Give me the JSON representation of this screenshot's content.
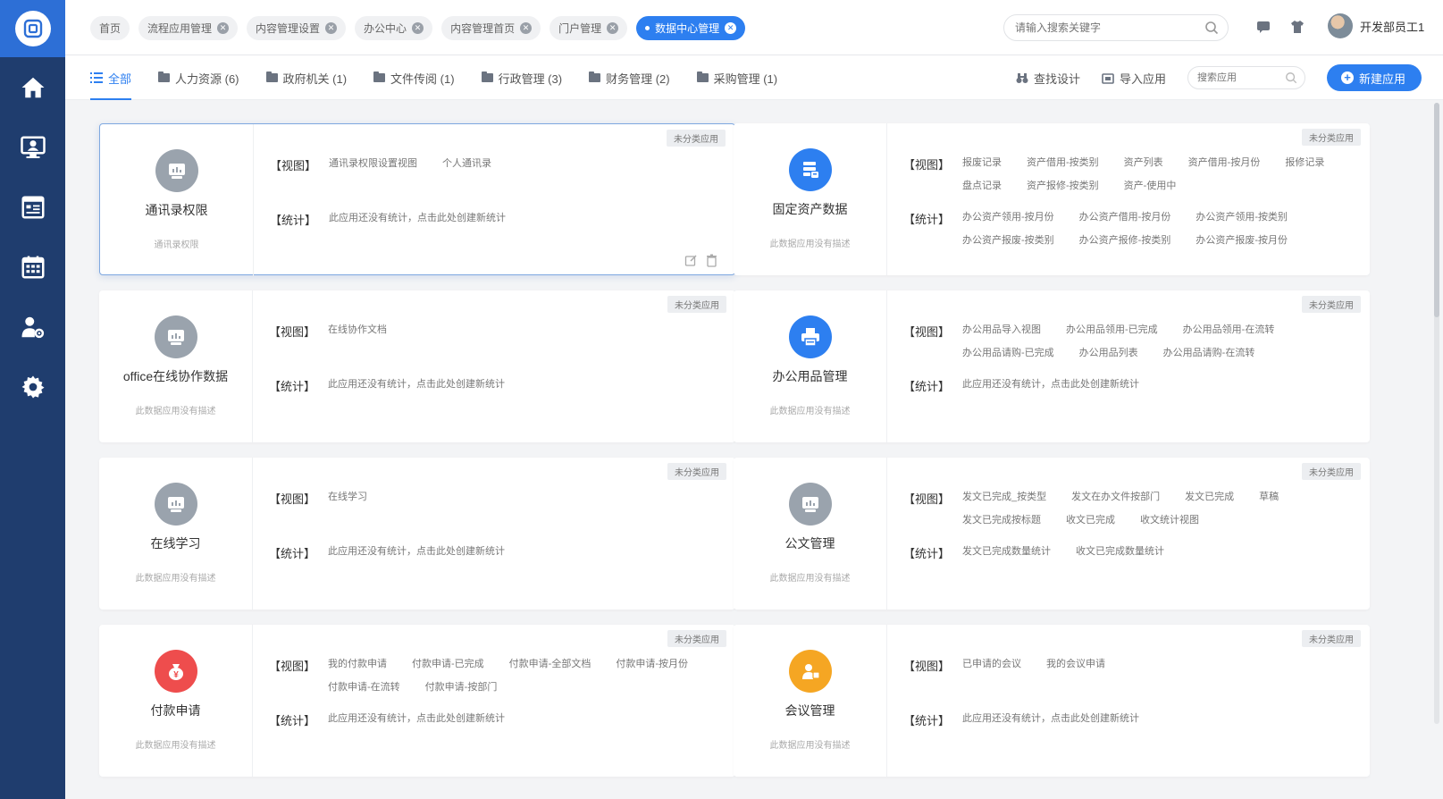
{
  "sidebar": {
    "logo": "app-logo-icon",
    "items": [
      {
        "icon": "home-icon",
        "name": "home"
      },
      {
        "icon": "user-monitor-icon",
        "name": "personnel"
      },
      {
        "icon": "document-list-icon",
        "name": "documents"
      },
      {
        "icon": "calendar-icon",
        "name": "calendar"
      },
      {
        "icon": "user-settings-icon",
        "name": "user-settings"
      },
      {
        "icon": "gear-icon",
        "name": "settings"
      }
    ]
  },
  "header": {
    "tabs": [
      {
        "label": "首页",
        "closable": false
      },
      {
        "label": "流程应用管理",
        "closable": true
      },
      {
        "label": "内容管理设置",
        "closable": true
      },
      {
        "label": "办公中心",
        "closable": true
      },
      {
        "label": "内容管理首页",
        "closable": true
      },
      {
        "label": "门户管理",
        "closable": true
      },
      {
        "label": "数据中心管理",
        "closable": true,
        "active": true
      }
    ],
    "search_placeholder": "请输入搜索关键字",
    "user_name": "开发部员工1"
  },
  "categories": {
    "items": [
      {
        "label": "全部",
        "active": true
      },
      {
        "label": "人力资源 (6)"
      },
      {
        "label": "政府机关 (1)"
      },
      {
        "label": "文件传阅 (1)"
      },
      {
        "label": "行政管理 (3)"
      },
      {
        "label": "财务管理 (2)"
      },
      {
        "label": "采购管理 (1)"
      }
    ],
    "find_design": "查找设计",
    "import_app": "导入应用",
    "search_app_placeholder": "搜索应用",
    "new_app": "新建应用"
  },
  "labels": {
    "view": "【视图】",
    "stat": "【统计】",
    "badge": "未分类应用",
    "no_stat": "此应用还没有统计，点击此处创建新统计"
  },
  "cards": [
    {
      "name": "通讯录权限",
      "desc": "通讯录权限",
      "icon": "database-icon",
      "color": "#9aa3ad",
      "views": [
        "通讯录权限设置视图",
        "个人通讯录"
      ],
      "stats": []
    },
    {
      "name": "固定资产数据",
      "desc": "此数据应用没有描述",
      "icon": "asset-data-icon",
      "color": "#2d7ff0",
      "views": [
        "报废记录",
        "资产借用-按类别",
        "资产列表",
        "资产借用-按月份",
        "报修记录",
        "盘点记录",
        "资产报修-按类别",
        "资产-使用中"
      ],
      "stats": [
        "办公资产领用-按月份",
        "办公资产借用-按月份",
        "办公资产领用-按类别",
        "办公资产报废-按类别",
        "办公资产报修-按类别",
        "办公资产报废-按月份"
      ]
    },
    {
      "name": "office在线协作数据",
      "desc": "此数据应用没有描述",
      "icon": "database-icon",
      "color": "#9aa3ad",
      "views": [
        "在线协作文档"
      ],
      "stats": []
    },
    {
      "name": "办公用品管理",
      "desc": "此数据应用没有描述",
      "icon": "printer-icon",
      "color": "#2d7ff0",
      "views": [
        "办公用品导入视图",
        "办公用品领用-已完成",
        "办公用品领用-在流转",
        "办公用品请购-已完成",
        "办公用品列表",
        "办公用品请购-在流转"
      ],
      "stats": []
    },
    {
      "name": "在线学习",
      "desc": "此数据应用没有描述",
      "icon": "database-icon",
      "color": "#9aa3ad",
      "views": [
        "在线学习"
      ],
      "stats": []
    },
    {
      "name": "公文管理",
      "desc": "此数据应用没有描述",
      "icon": "database-icon",
      "color": "#9aa3ad",
      "views": [
        "发文已完成_按类型",
        "发文在办文件按部门",
        "发文已完成",
        "草稿",
        "发文已完成按标题",
        "收文已完成",
        "收文统计视图"
      ],
      "stats": [
        "发文已完成数量统计",
        "收文已完成数量统计"
      ]
    },
    {
      "name": "付款申请",
      "desc": "此数据应用没有描述",
      "icon": "money-bag-icon",
      "color": "#ee4d4d",
      "views": [
        "我的付款申请",
        "付款申请-已完成",
        "付款申请-全部文档",
        "付款申请-按月份",
        "付款申请-在流转",
        "付款申请-按部门"
      ],
      "stats": []
    },
    {
      "name": "会议管理",
      "desc": "此数据应用没有描述",
      "icon": "meeting-user-icon",
      "color": "#f5a623",
      "views": [
        "已申请的会议",
        "我的会议申请"
      ],
      "stats": []
    }
  ]
}
